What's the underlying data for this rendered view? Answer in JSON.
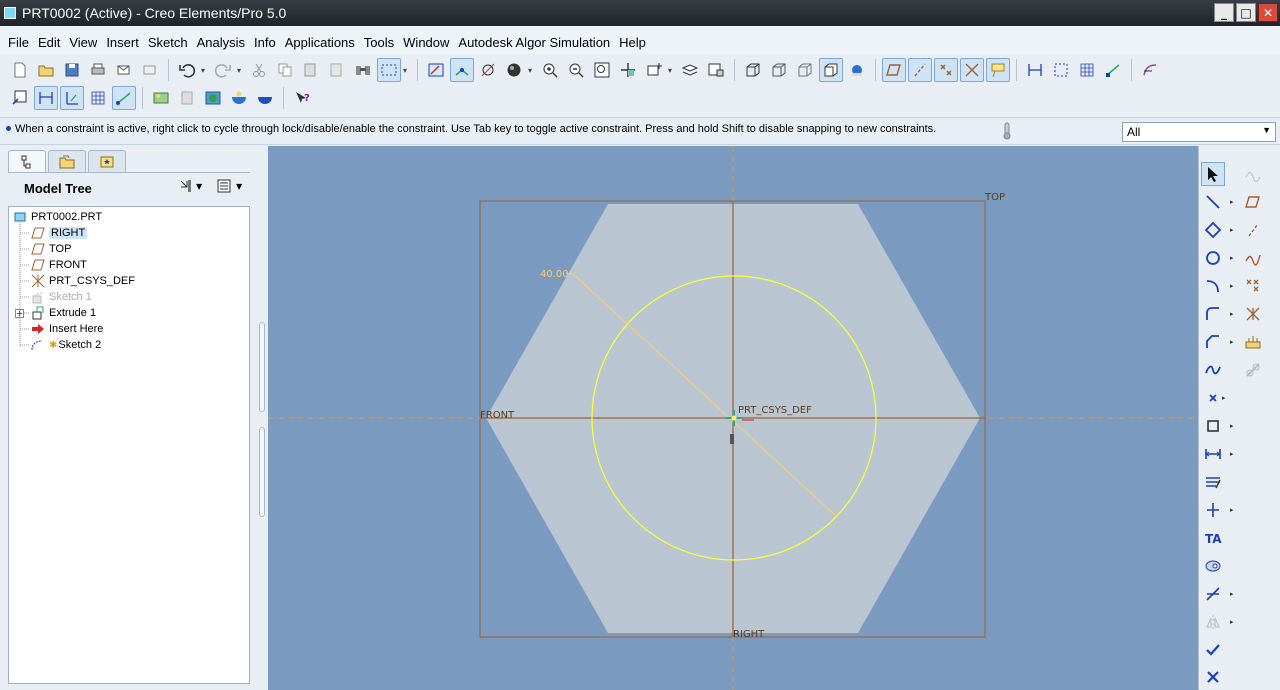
{
  "window": {
    "title": "PRT0002 (Active) - Creo Elements/Pro 5.0",
    "buttons": [
      "minimize",
      "maximize",
      "close"
    ]
  },
  "menu": [
    "File",
    "Edit",
    "View",
    "Insert",
    "Sketch",
    "Analysis",
    "Info",
    "Applications",
    "Tools",
    "Window",
    "Autodesk Algor Simulation",
    "Help"
  ],
  "message": {
    "text": "When a constraint is active, right click to cycle through lock/disable/enable the constraint. Use Tab key to toggle active constraint. Press and hold Shift to disable snapping to new constraints.",
    "filter_value": "All"
  },
  "model_tree": {
    "header": "Model Tree",
    "items": [
      {
        "label": "PRT0002.PRT",
        "icon": "part-icon"
      },
      {
        "label": "RIGHT",
        "icon": "datum-plane-icon",
        "highlighted": true
      },
      {
        "label": "TOP",
        "icon": "datum-plane-icon"
      },
      {
        "label": "FRONT",
        "icon": "datum-plane-icon"
      },
      {
        "label": "PRT_CSYS_DEF",
        "icon": "csys-icon"
      },
      {
        "label": "Sketch 1",
        "icon": "sketch-icon",
        "disabled": true
      },
      {
        "label": "Extrude 1",
        "icon": "extrude-icon"
      },
      {
        "label": "Insert Here",
        "icon": "insert-arrow-icon"
      },
      {
        "label": "Sketch 2",
        "icon": "sketch-active-icon"
      }
    ]
  },
  "graphics": {
    "datum_labels": {
      "top": "TOP",
      "front": "FRONT",
      "right": "RIGHT",
      "csys": "PRT_CSYS_DEF"
    },
    "dimension": "40.00",
    "colors": {
      "background": "#7a9abf",
      "hexagon": "#b9c6d2",
      "datum": "#a06030",
      "circle": "#ffff33",
      "dimension": "#ffcc66"
    }
  }
}
